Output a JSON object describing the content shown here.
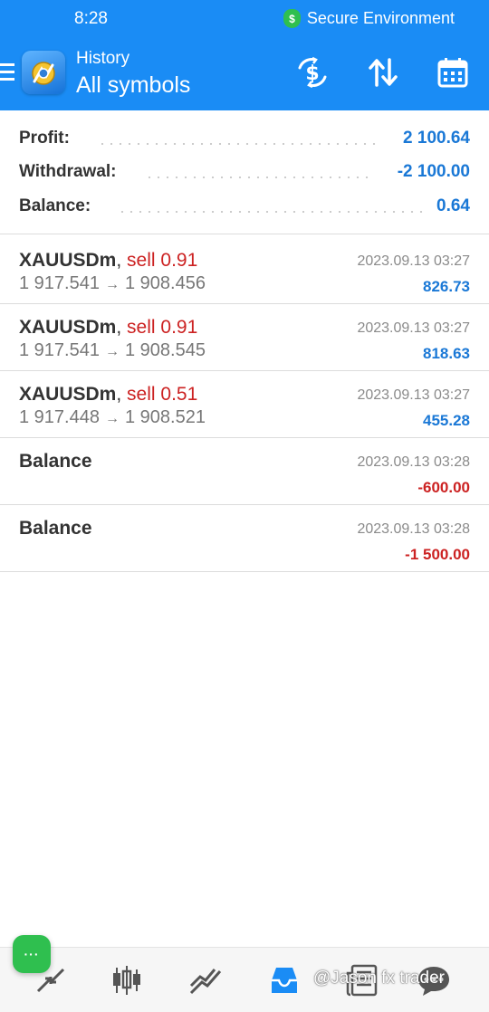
{
  "status_bar": {
    "time": "8:28",
    "secure_label": "Secure Environment",
    "secure_badge": "$"
  },
  "header": {
    "subtitle": "History",
    "title": "All symbols"
  },
  "summary": [
    {
      "label": "Profit:",
      "value": "2 100.64"
    },
    {
      "label": "Withdrawal:",
      "value": "-2 100.00"
    },
    {
      "label": "Balance:",
      "value": "0.64"
    }
  ],
  "deals": [
    {
      "symbol": "XAUUSDm",
      "sep": ",",
      "side": "sell 0.91",
      "open": "1 917.541",
      "arrow": "→",
      "close": "1 908.456",
      "time": "2023.09.13 03:27",
      "profit": "826.73"
    },
    {
      "symbol": "XAUUSDm",
      "sep": ",",
      "side": "sell 0.91",
      "open": "1 917.541",
      "arrow": "→",
      "close": "1 908.545",
      "time": "2023.09.13 03:27",
      "profit": "818.63"
    },
    {
      "symbol": "XAUUSDm",
      "sep": ",",
      "side": "sell 0.51",
      "open": "1 917.448",
      "arrow": "→",
      "close": "1 908.521",
      "time": "2023.09.13 03:27",
      "profit": "455.28"
    }
  ],
  "balance_ops": [
    {
      "label": "Balance",
      "time": "2023.09.13 03:28",
      "amount": "-600.00"
    },
    {
      "label": "Balance",
      "time": "2023.09.13 03:28",
      "amount": "-1 500.00"
    }
  ],
  "chat_button": {
    "label": "···"
  },
  "watermark": "@Jason fx trader",
  "colors": {
    "header_blue": "#1a8cf5",
    "profit_blue": "#1a78d6",
    "loss_red": "#cc2222",
    "secure_green": "#2fbf4f"
  },
  "icons": {
    "header": [
      "dollar-exchange-icon",
      "sort-icon",
      "calendar-icon"
    ],
    "nav": [
      "quotes-icon",
      "chart-icon",
      "trade-icon",
      "history-icon",
      "news-icon",
      "chat-icon"
    ]
  }
}
